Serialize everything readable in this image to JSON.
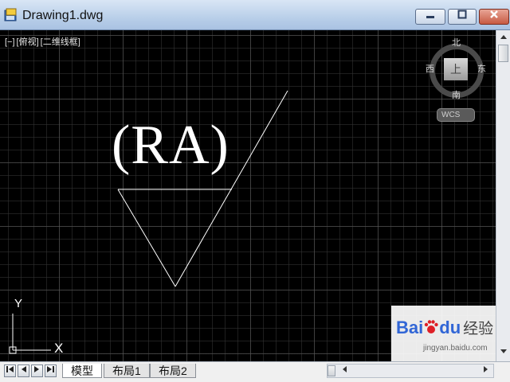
{
  "window": {
    "title": "Drawing1.dwg",
    "minimize_icon": "minimize-icon",
    "maximize_icon": "maximize-icon",
    "close_icon": "close-icon"
  },
  "viewport": {
    "controls": [
      "[−]",
      "[俯视]",
      "[二维线框]"
    ]
  },
  "drawing": {
    "text": "(RA)"
  },
  "viewcube": {
    "north": "北",
    "south": "南",
    "west": "西",
    "east": "东",
    "face": "上",
    "wcs_label": "WCS"
  },
  "ucs": {
    "x_label": "X",
    "y_label": "Y"
  },
  "layout_tabs": [
    "模型",
    "布局1",
    "布局2"
  ],
  "nav_buttons": [
    "first-icon",
    "prev-icon",
    "next-icon",
    "last-icon"
  ],
  "watermark": {
    "brand_a": "Bai",
    "brand_b": "du",
    "brand_c": "经验",
    "url": "jingyan.baidu.com"
  },
  "colors": {
    "canvas_bg": "#000000",
    "drawing_lines": "#ffffff",
    "titlebar": "#b9cfe9"
  }
}
